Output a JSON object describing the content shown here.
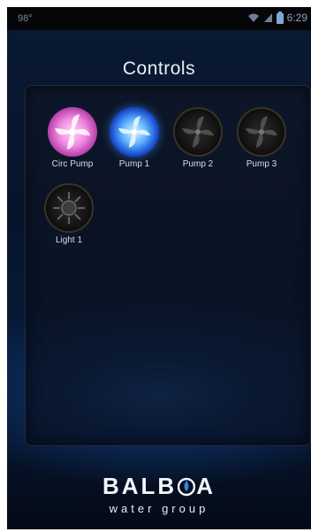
{
  "status": {
    "left_text": "98°",
    "time": "6:29"
  },
  "title": "Controls",
  "controls": [
    {
      "label": "Circ Pump",
      "state": "on",
      "color": "#f08ae0",
      "icon": "fan-icon"
    },
    {
      "label": "Pump 1",
      "state": "on",
      "color": "#5fb4ff",
      "icon": "fan-icon"
    },
    {
      "label": "Pump 2",
      "state": "off",
      "color": "#2b2b2b",
      "icon": "fan-icon"
    },
    {
      "label": "Pump 3",
      "state": "off",
      "color": "#2b2b2b",
      "icon": "fan-icon"
    },
    {
      "label": "Light 1",
      "state": "off",
      "color": "#2b2b2b",
      "icon": "light-icon"
    }
  ],
  "logo": {
    "brand_left": "BALB",
    "brand_right": "A",
    "subtitle": "water group"
  }
}
